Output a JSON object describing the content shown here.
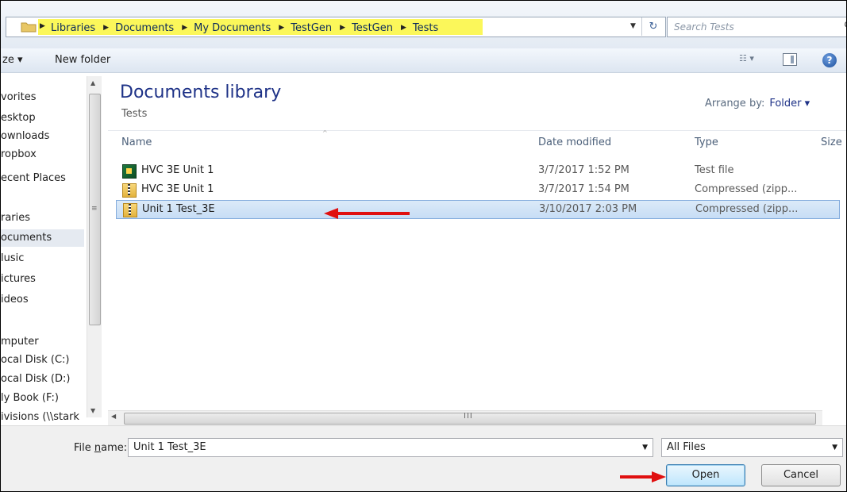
{
  "address": {
    "crumbs": [
      "Libraries",
      "Documents",
      "My Documents",
      "TestGen",
      "TestGen",
      "Tests"
    ],
    "search_placeholder": "Search Tests",
    "highlight_color": "#fbf75a"
  },
  "toolbar": {
    "organize_label": "ze ▾",
    "new_folder_label": "New folder"
  },
  "nav": {
    "items": [
      {
        "label": "vorites"
      },
      {
        "label": "esktop"
      },
      {
        "label": "ownloads"
      },
      {
        "label": "ropbox"
      },
      {
        "label": "ecent Places"
      },
      {
        "label": "raries"
      },
      {
        "label": "ocuments"
      },
      {
        "label": "lusic"
      },
      {
        "label": "ictures"
      },
      {
        "label": "ideos"
      },
      {
        "label": "mputer"
      },
      {
        "label": "ocal Disk (C:)"
      },
      {
        "label": "ocal Disk (D:)"
      },
      {
        "label": "ly Book (F:)"
      },
      {
        "label": "ivisions (\\\\stark"
      }
    ]
  },
  "content": {
    "library_title": "Documents library",
    "library_subtitle": "Tests",
    "arrange_label": "Arrange by:",
    "arrange_value": "Folder ▾",
    "columns": {
      "name": "Name",
      "date": "Date modified",
      "type": "Type",
      "size": "Size"
    },
    "files": [
      {
        "name": "HVC 3E Unit 1",
        "date": "3/7/2017 1:52 PM",
        "type": "Test file",
        "icon": "test-file-icon"
      },
      {
        "name": "HVC 3E Unit 1",
        "date": "3/7/2017 1:54 PM",
        "type": "Compressed (zipp...",
        "icon": "zip-folder-icon"
      },
      {
        "name": "Unit 1 Test_3E",
        "date": "3/10/2017 2:03 PM",
        "type": "Compressed (zipp...",
        "icon": "zip-folder-icon",
        "selected": true
      }
    ]
  },
  "bottom": {
    "file_name_label_pre": "File ",
    "file_name_label_u": "n",
    "file_name_label_post": "ame:",
    "file_name_value": "Unit 1 Test_3E",
    "filter_value": "All Files",
    "open_label": "Open",
    "cancel_label": "Cancel"
  },
  "annotation_color": "#e01010"
}
